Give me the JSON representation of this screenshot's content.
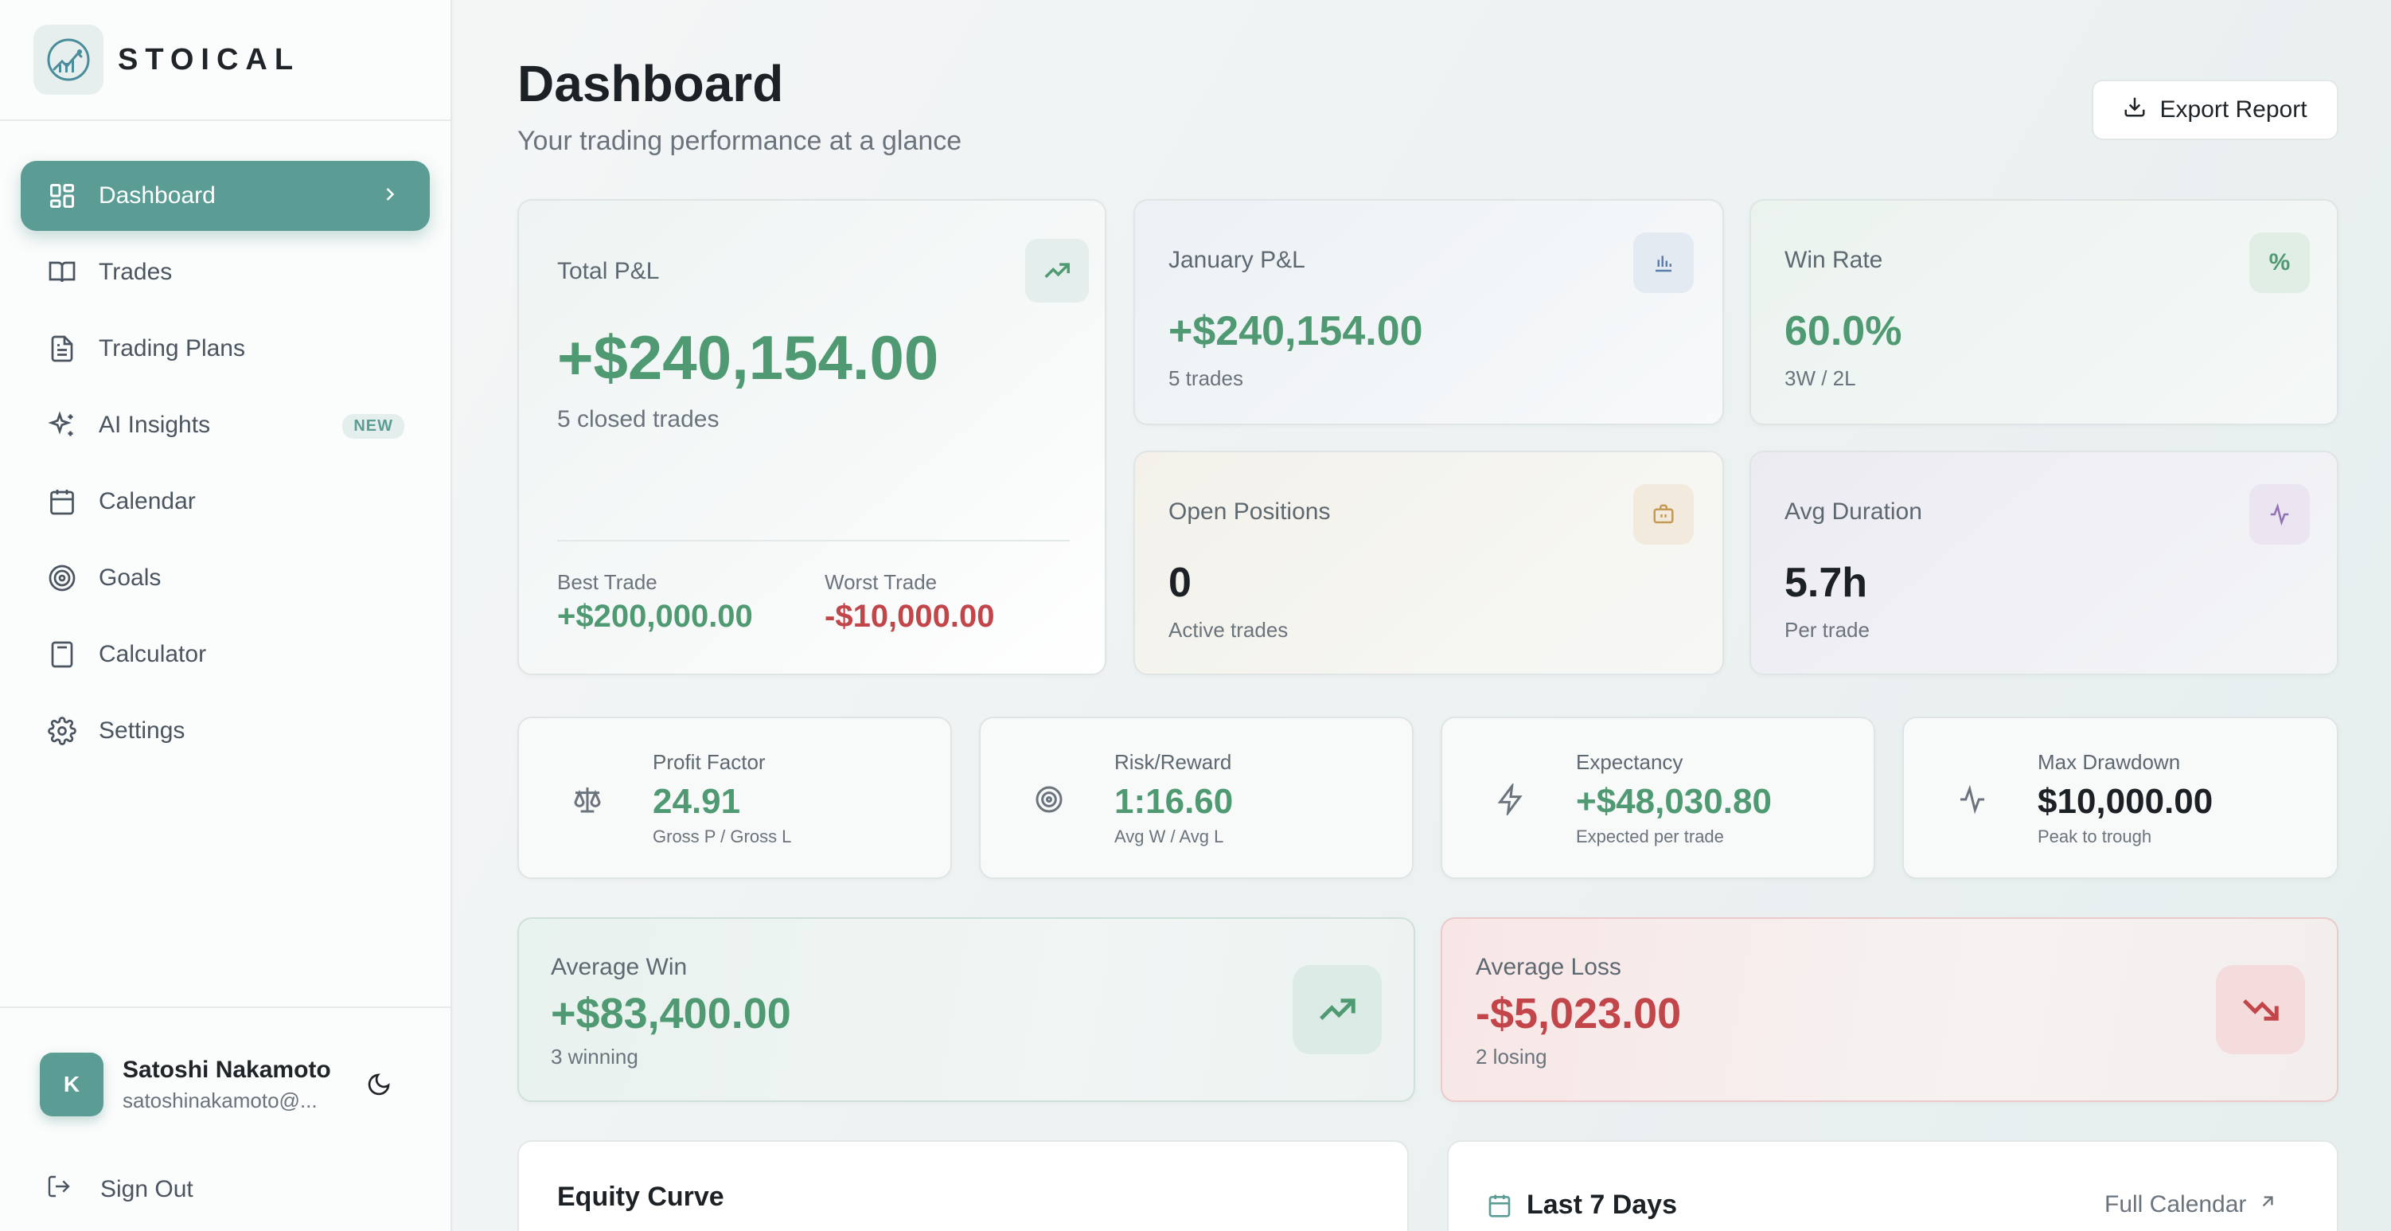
{
  "brand": {
    "name": "STOICAL"
  },
  "nav": {
    "items": [
      {
        "label": "Dashboard"
      },
      {
        "label": "Trades"
      },
      {
        "label": "Trading Plans"
      },
      {
        "label": "AI Insights",
        "badge": "NEW"
      },
      {
        "label": "Calendar"
      },
      {
        "label": "Goals"
      },
      {
        "label": "Calculator"
      },
      {
        "label": "Settings"
      }
    ]
  },
  "user": {
    "initial": "K",
    "name": "Satoshi Nakamoto",
    "email": "satoshinakamoto@..."
  },
  "signout": {
    "label": "Sign Out"
  },
  "header": {
    "title": "Dashboard",
    "subtitle": "Your trading performance at a glance",
    "export_label": "Export Report"
  },
  "total_pnl": {
    "label": "Total P&L",
    "value": "+$240,154.00",
    "sub": "5 closed trades",
    "best_label": "Best Trade",
    "best_value": "+$200,000.00",
    "worst_label": "Worst Trade",
    "worst_value": "-$10,000.00"
  },
  "january_pnl": {
    "label": "January P&L",
    "value": "+$240,154.00",
    "sub": "5 trades"
  },
  "win_rate": {
    "label": "Win Rate",
    "value": "60.0%",
    "sub": "3W / 2L",
    "icon_glyph": "%"
  },
  "open_positions": {
    "label": "Open Positions",
    "value": "0",
    "sub": "Active trades"
  },
  "avg_duration": {
    "label": "Avg Duration",
    "value": "5.7h",
    "sub": "Per trade"
  },
  "metrics": [
    {
      "label": "Profit Factor",
      "value": "24.91",
      "sub": "Gross P / Gross L"
    },
    {
      "label": "Risk/Reward",
      "value": "1:16.60",
      "sub": "Avg W / Avg L"
    },
    {
      "label": "Expectancy",
      "value": "+$48,030.80",
      "sub": "Expected per trade"
    },
    {
      "label": "Max Drawdown",
      "value": "$10,000.00",
      "sub": "Peak to trough"
    }
  ],
  "average_win": {
    "label": "Average Win",
    "value": "+$83,400.00",
    "sub": "3 winning"
  },
  "average_loss": {
    "label": "Average Loss",
    "value": "-$5,023.00",
    "sub": "2 losing"
  },
  "equity_curve": {
    "title": "Equity Curve"
  },
  "last7": {
    "title": "Last 7 Days",
    "link": "Full Calendar"
  },
  "colors": {
    "accent": "#5b9d95",
    "positive": "#4f9a72",
    "negative": "#c2454a"
  }
}
